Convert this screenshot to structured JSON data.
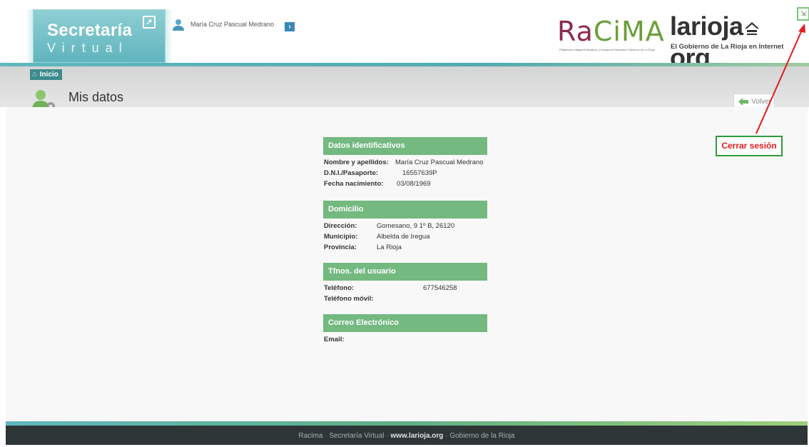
{
  "header": {
    "app_title": "Secretaría",
    "app_subtitle": "Virtual",
    "user_name": "María Cruz Pascual Medrano",
    "racima_logo": "RaCiMA",
    "racima_tagline": "Plataforma Integral Educativa | Consejería Educación Gobierno de La Rioja",
    "larioja_logo_text": "larioja",
    "larioja_logo_tld": "org",
    "larioja_tagline": "El Gobierno de La Rioja en Internet"
  },
  "nav": {
    "breadcrumb_home": "Inicio",
    "page_title": "Mis datos",
    "back_button": "Volver"
  },
  "sections": {
    "identificativos": {
      "title": "Datos identificativos",
      "nombre_label": "Nombre y apellidos:",
      "nombre_value": "María Cruz Pascual Medrano",
      "dni_label": "D.N.I./Pasaporte:",
      "dni_value": "16557639P",
      "fecha_label": "Fecha nacimiento:",
      "fecha_value": "03/08/1969"
    },
    "domicilio": {
      "title": "Domicilio",
      "direccion_label": "Dirección:",
      "direccion_value": "Gomesano, 9 1º B, 26120",
      "municipio_label": "Municipio:",
      "municipio_value": "Albelda de Iregua",
      "provincia_label": "Provincia:",
      "provincia_value": "La Rioja"
    },
    "telefonos": {
      "title": "Tfnos. del usuario",
      "telefono_label": "Teléfono:",
      "telefono_value": "677546258",
      "movil_label": "Teléfono móvil:",
      "movil_value": ""
    },
    "correo": {
      "title": "Correo Electrónico",
      "email_label": "Email:",
      "email_value": ""
    }
  },
  "annotation": {
    "logout_label": "Cerrar sesión"
  },
  "footer": {
    "item1": "Racima",
    "item2": "Secretaría Virtual",
    "item3": "www.larioja.org",
    "item4": "Gobierno de la Rioja",
    "separator": "·"
  },
  "colors": {
    "accent_teal": "#5fb7bd",
    "section_green": "#73b980",
    "annotation_red": "#e31b1b",
    "footer_dark": "#2e3537"
  }
}
